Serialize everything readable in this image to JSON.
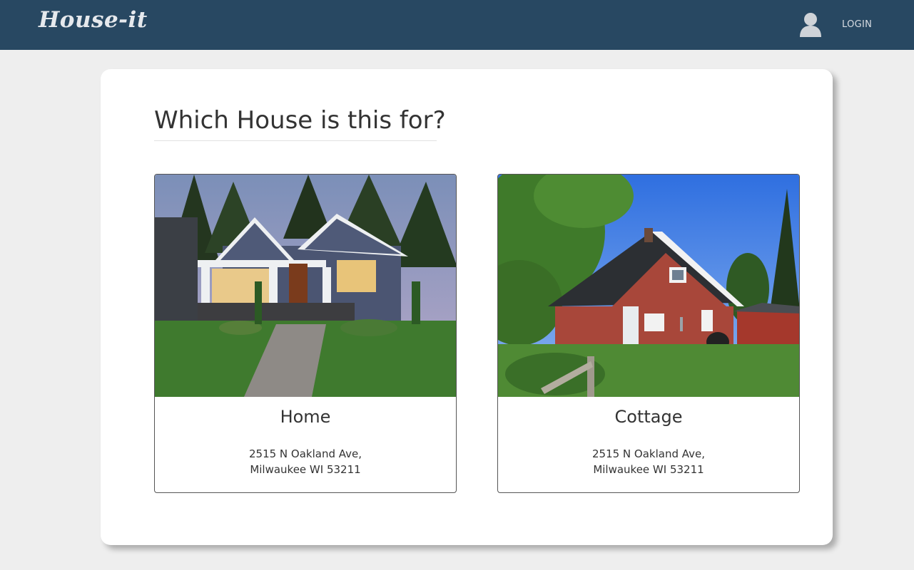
{
  "header": {
    "logo": "House-it",
    "login_label": "LOGIN",
    "user_icon": "user-icon",
    "background_color": "#284862"
  },
  "main": {
    "question": "Which House is this for?",
    "houses": [
      {
        "name": "Home",
        "address_line1": "2515 N Oakland Ave,",
        "address_line2": "Milwaukee WI 53211",
        "photo": "house-photo-blue-craftsman"
      },
      {
        "name": "Cottage",
        "address_line1": "2515 N Oakland Ave,",
        "address_line2": "Milwaukee WI 53211",
        "photo": "house-photo-red-log-cabin"
      }
    ]
  }
}
